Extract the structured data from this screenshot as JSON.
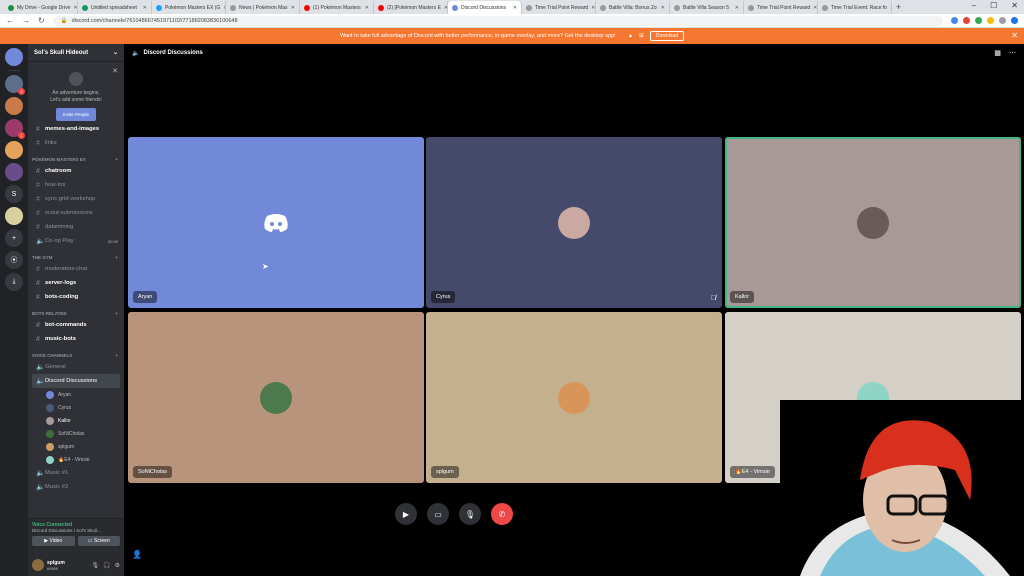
{
  "browser": {
    "tabs": [
      {
        "label": "My Drive - Google Drive",
        "color": "#1e8e3e"
      },
      {
        "label": "Untitled spreadsheet",
        "color": "#0f9d58"
      },
      {
        "label": "Pokémon Masters EX (G",
        "color": "#1da1f2"
      },
      {
        "label": "News | Pokémon Mas",
        "color": "#999999"
      },
      {
        "label": "(1) Pokémon Masters",
        "color": "#ff0000"
      },
      {
        "label": "(2) [Pokémon Masters E",
        "color": "#ff0000"
      },
      {
        "label": "Discord Discussions",
        "color": "#7289da"
      },
      {
        "label": "Time Trial Point Reward",
        "color": "#999999"
      },
      {
        "label": "Battle Villa: Bonus Zo",
        "color": "#999999"
      },
      {
        "label": "Battle Villa Season 5",
        "color": "#999999"
      },
      {
        "label": "Time Trial Point Reward",
        "color": "#999999"
      },
      {
        "label": "Time Trial Event: Race fo",
        "color": "#999999"
      }
    ],
    "new_tab": "+",
    "url": "discord.com/channels/761048667451971102/771882083836100648"
  },
  "banner": {
    "text": "Want to take full advantage of Discord with better performance, in-game overlay, and more? Get the desktop app!",
    "download": "Download"
  },
  "guilds": [
    {
      "label": "",
      "color": "#7289da",
      "badge": ""
    },
    {
      "label": "",
      "color": "#5b6f8a",
      "badge": "2"
    },
    {
      "label": "",
      "color": "#c97b4a",
      "badge": ""
    },
    {
      "label": "",
      "color": "#9b3b6b",
      "badge": "1"
    },
    {
      "label": "",
      "color": "#e3a35b",
      "badge": ""
    },
    {
      "label": "",
      "color": "#6a4b8c",
      "badge": ""
    },
    {
      "label": "S",
      "color": "#36393f",
      "badge": ""
    },
    {
      "label": "",
      "color": "#d9d0a0",
      "badge": ""
    },
    {
      "label": "+",
      "color": "#36393f",
      "badge": ""
    },
    {
      "label": "⦿",
      "color": "#36393f",
      "badge": ""
    },
    {
      "label": "⤓",
      "color": "#36393f",
      "badge": ""
    }
  ],
  "server": {
    "name": "Sol's Skull Hideout",
    "welcome_line1": "An adventure begins.",
    "welcome_line2": "Let's add some friends!",
    "invite": "Invite People"
  },
  "channels": {
    "top": [
      {
        "name": "memes-and-images",
        "unread": true
      },
      {
        "name": "links",
        "unread": false
      }
    ],
    "cat_pme": "POKÉMON MASTERS EX",
    "pme": [
      {
        "name": "chatroom",
        "unread": true
      },
      {
        "name": "how-tos",
        "unread": false
      },
      {
        "name": "sync-grid-workshop",
        "unread": false
      },
      {
        "name": "scout-submissions",
        "unread": false
      },
      {
        "name": "datamining",
        "unread": false
      },
      {
        "name": "Co-op Play",
        "unread": false,
        "badge": "00  00"
      }
    ],
    "cat_gym": "THE GYM",
    "gym": [
      {
        "name": "moderators-chat",
        "unread": false
      },
      {
        "name": "server-logs",
        "unread": true
      },
      {
        "name": "bots-coding",
        "unread": true
      }
    ],
    "cat_bots": "BOTS RELATED",
    "bots": [
      {
        "name": "bot-commands",
        "unread": true
      },
      {
        "name": "music-bots",
        "unread": true
      }
    ],
    "cat_voice": "VOICE CHANNELS",
    "voice_general": "General",
    "voice_current": "Discord Discussions",
    "voice_users": [
      {
        "name": "Aryan",
        "color": "#7289da"
      },
      {
        "name": "Cyrus",
        "color": "#4a5a7a"
      },
      {
        "name": "Kallor",
        "color": "#a99a9a"
      },
      {
        "name": "SoNiCholas",
        "color": "#3d6e3d"
      },
      {
        "name": "splgum",
        "color": "#c9a060"
      },
      {
        "name": "🔥E4 - Vimsie",
        "color": "#8fd4c4"
      }
    ],
    "voice_more": [
      {
        "name": "Music #1"
      },
      {
        "name": "Music #2"
      }
    ]
  },
  "voice_panel": {
    "status": "Voice Connected",
    "sub": "Discord Discussions / Sol's Skull...",
    "video": "Video",
    "screen": "Screen"
  },
  "user": {
    "name": "splgum",
    "tag": "#9909"
  },
  "main": {
    "title": "Discord Discussions"
  },
  "tiles": [
    {
      "name": "Aryan",
      "bg": "#7289da",
      "avatar": "#7289da"
    },
    {
      "name": "Cyrus",
      "bg": "#454a6a",
      "avatar": "#c9a9a0"
    },
    {
      "name": "Kallor",
      "bg": "#a89898",
      "avatar": "#6b5a5a"
    },
    {
      "name": "SoNiCholas",
      "bg": "#b8947c",
      "avatar": "#4c7a4c"
    },
    {
      "name": "splgum",
      "bg": "#c5b08e",
      "avatar": "#d7955a"
    },
    {
      "name": "🔥E4 - Vimsie",
      "bg": "#d4d0c8",
      "avatar": "#8fd4c4"
    }
  ]
}
